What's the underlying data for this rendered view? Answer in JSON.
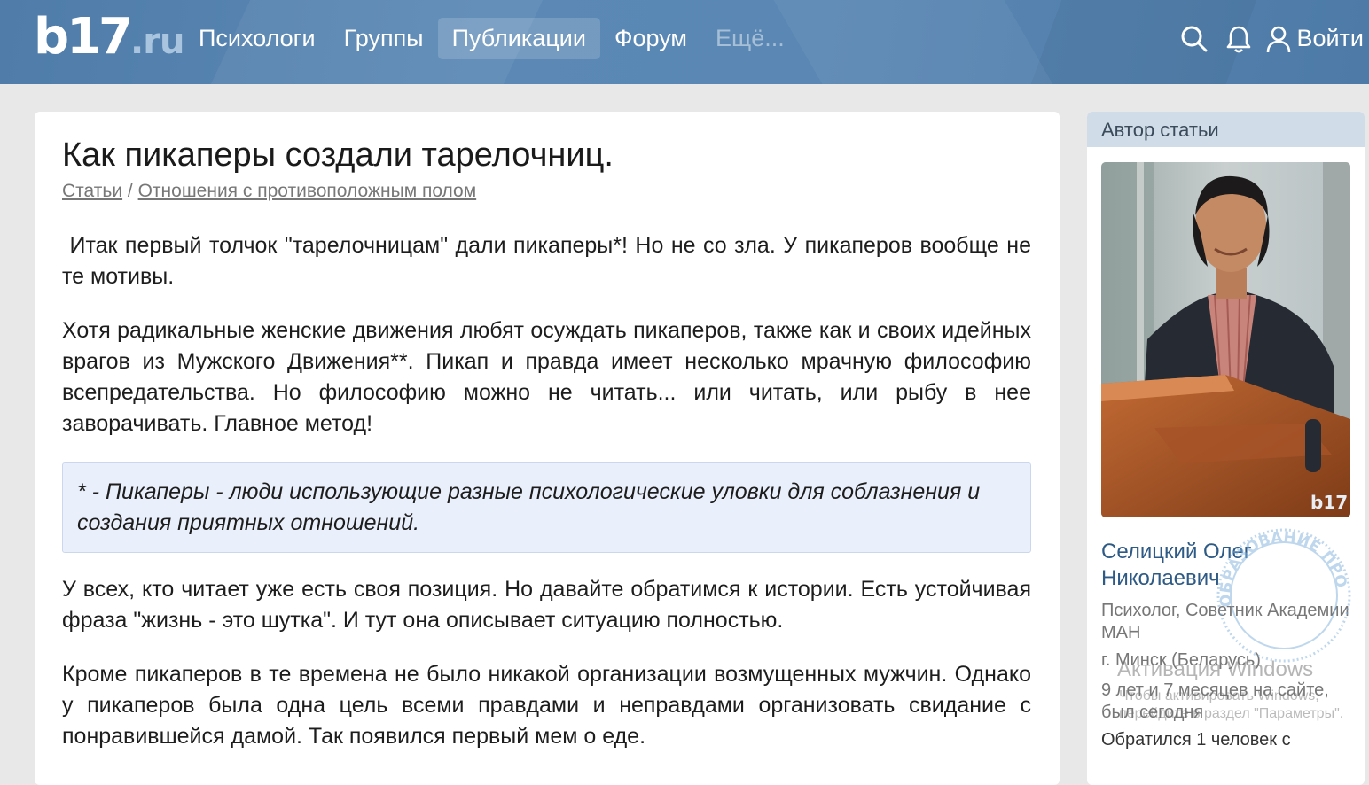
{
  "header": {
    "logo_main": "b17",
    "logo_tld": ".ru",
    "nav": [
      "Психологи",
      "Группы",
      "Публикации",
      "Форум",
      "Ещё..."
    ],
    "login_label": "Войти"
  },
  "article": {
    "title": "Как пикаперы создали тарелочниц.",
    "breadcrumb": [
      "Статьи",
      "Отношения с противоположным полом"
    ],
    "breadcrumb_sep": "/",
    "paragraphs": [
      " Итак первый толчок \"тарелочницам\" дали пикаперы*! Но не со зла. У пикаперов вообще не те мотивы.",
      "Хотя радикальные женские движения любят осуждать пикаперов, также как и своих идейных врагов из Мужского Движения**. Пикап и правда имеет несколько мрачную философию всепредательства. Но философию можно не читать... или читать, или рыбу в нее заворачивать. Главное метод!"
    ],
    "note": "* - Пикаперы - люди использующие разные психологические уловки для соблазнения и создания приятных отношений.",
    "paragraphs_after": [
      "У всех, кто читает уже есть своя позиция. Но давайте обратимся к истории. Есть устойчивая фраза \"жизнь - это шутка\". И тут она описывает ситуацию полностью.",
      "Кроме пикаперов в те времена не было никакой организации возмущенных мужчин. Однако у пикаперов была одна цель всеми правдами и неправдами организовать свидание с понравившейся дамой. Так появился первый мем о еде."
    ]
  },
  "sidebar": {
    "heading": "Автор статьи",
    "photo_mark": "b17",
    "name": "Селицкий Олег Николаевич",
    "role": "Психолог, Советник Академии МАН",
    "city": "г. Минск (Беларусь)",
    "since": "9 лет и 7 месяцев на сайте, был сегодня",
    "count": "Обратился 1 человек с",
    "stamp_text": "ОБРАЗОВАНИЕ ПРОВЕРЕНО"
  },
  "overlay": {
    "activation_title": "Активация Windows",
    "activation_hint": "Чтобы активировать Windows, перейдите в раздел \"Параметры\"."
  },
  "colors": {
    "header_bg": "#5583b0",
    "link": "#2e5a86",
    "note_bg": "#eaf0fb",
    "sidebar_head_bg": "#d0dde9"
  }
}
